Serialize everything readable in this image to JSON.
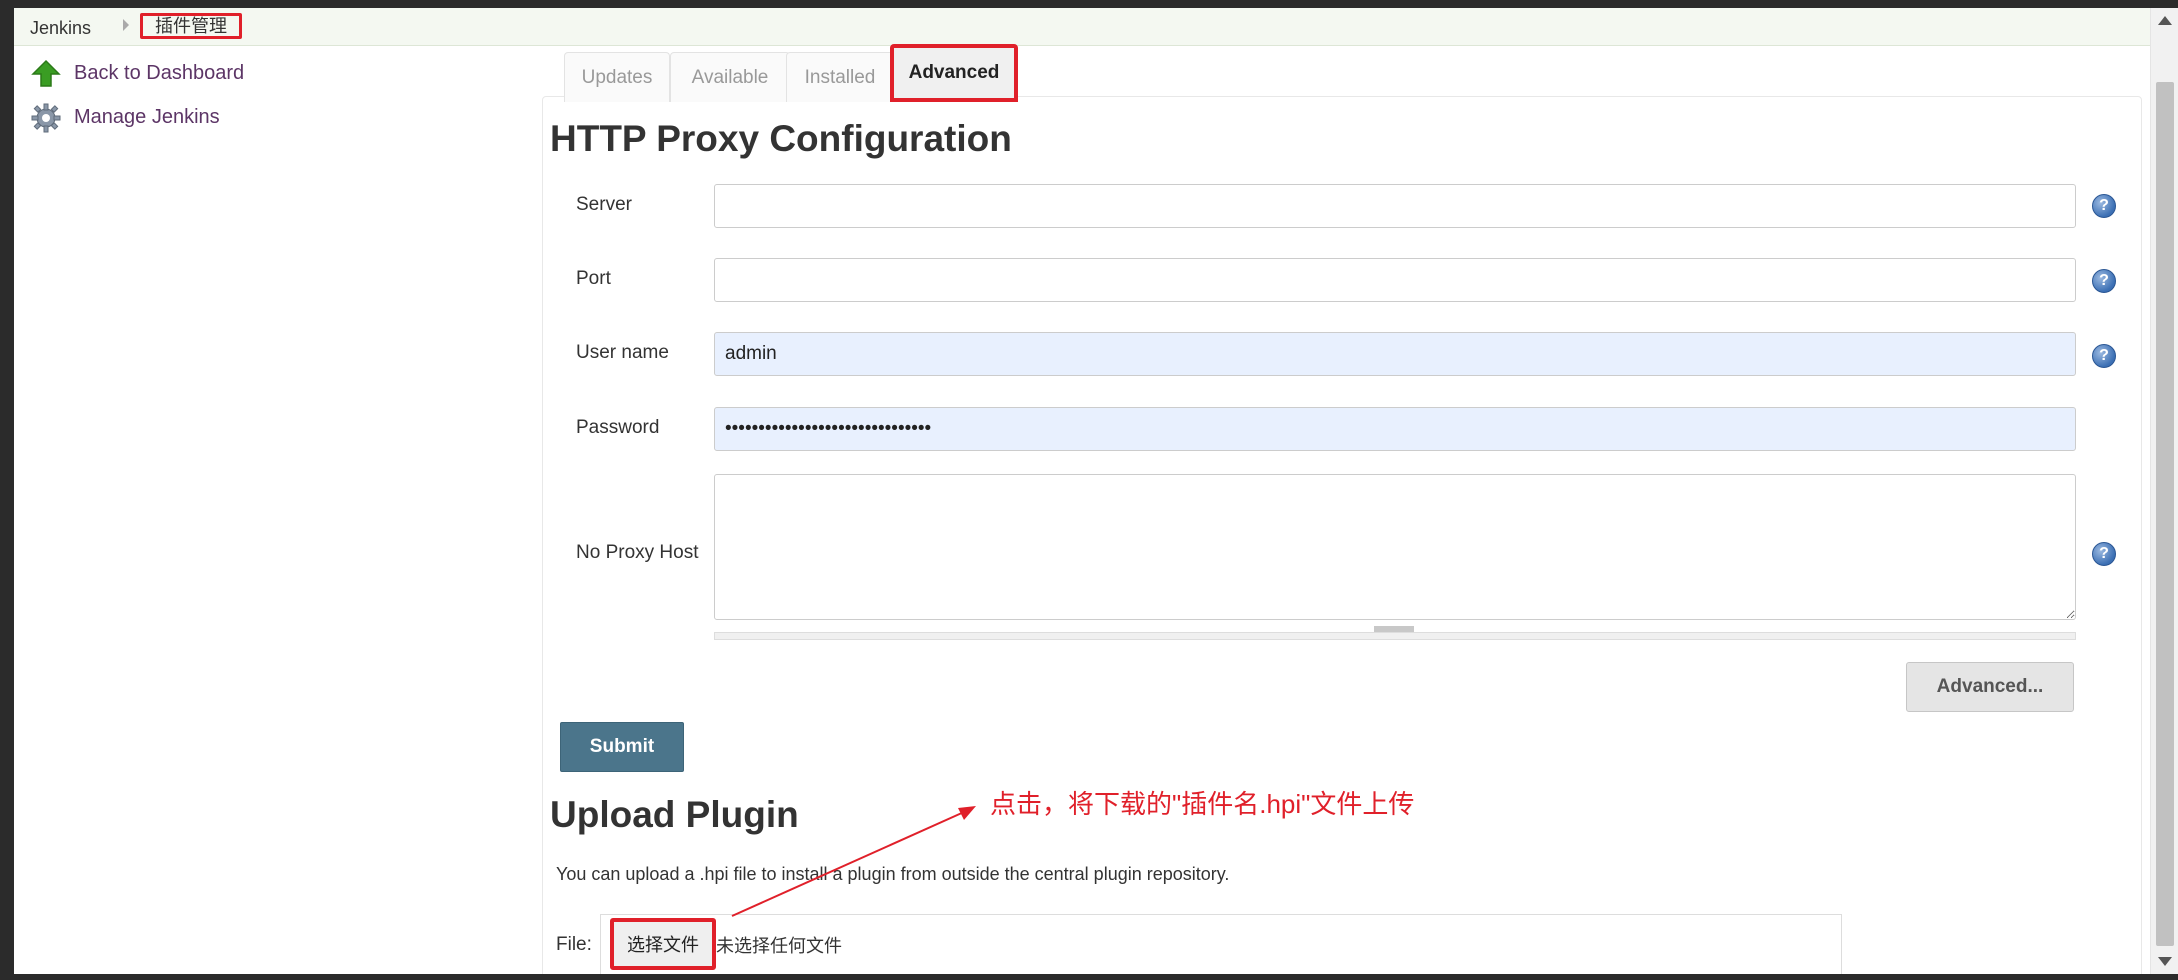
{
  "breadcrumb": {
    "home": "Jenkins",
    "current": "插件管理"
  },
  "side_panel": {
    "items": [
      {
        "label": "Back to Dashboard",
        "icon": "up-arrow-icon"
      },
      {
        "label": "Manage Jenkins",
        "icon": "gear-icon"
      }
    ]
  },
  "tabs": [
    {
      "label": "Updates",
      "active": false
    },
    {
      "label": "Available",
      "active": false
    },
    {
      "label": "Installed",
      "active": false
    },
    {
      "label": "Advanced",
      "active": true
    }
  ],
  "proxy": {
    "title": "HTTP Proxy Configuration",
    "server_label": "Server",
    "server_value": "",
    "port_label": "Port",
    "port_value": "",
    "username_label": "User name",
    "username_value": "admin",
    "password_label": "Password",
    "password_value": "secretpassword12345678901234567",
    "noproxy_label": "No Proxy Host",
    "noproxy_value": "",
    "advanced_button": "Advanced...",
    "submit_button": "Submit"
  },
  "upload": {
    "title": "Upload Plugin",
    "description": "You can upload a .hpi file to install a plugin from outside the central plugin repository.",
    "file_label": "File:",
    "choose_button": "选择文件",
    "no_file_text": "未选择任何文件"
  },
  "annotation": {
    "text": "点击，将下载的\"插件名.hpi\"文件上传",
    "color": "#e0202a"
  },
  "colors": {
    "submit_bg": "#4b758b",
    "highlight": "#e0202a",
    "link": "#5c3566"
  }
}
